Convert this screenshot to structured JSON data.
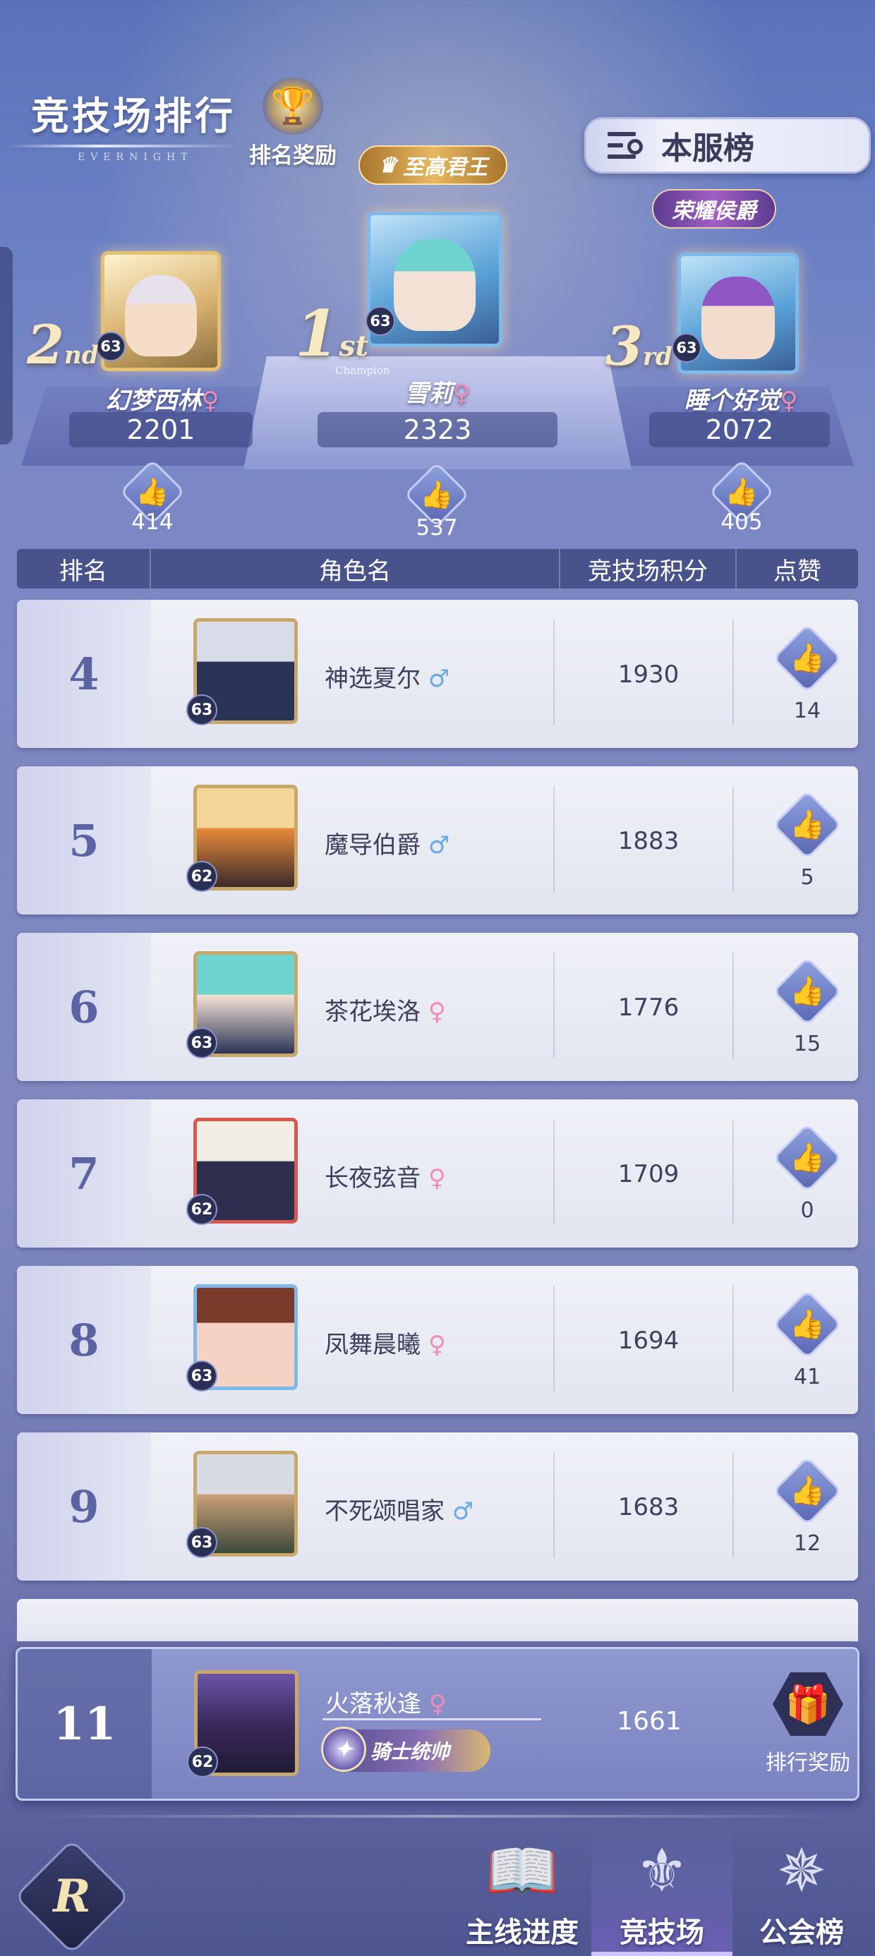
{
  "header": {
    "title": "竞技场排行",
    "subtitle": "EVERNIGHT",
    "reward_label": "排名奖励",
    "server_button": "本服榜"
  },
  "podium": {
    "champion_text": "Champion",
    "first": {
      "rank": "1",
      "suffix": "st",
      "title": "至高君王",
      "name": "雪莉",
      "gender": "♀",
      "score": "2323",
      "likes": "537",
      "level": "63"
    },
    "second": {
      "rank": "2",
      "suffix": "nd",
      "name": "幻梦西林",
      "gender": "♀",
      "score": "2201",
      "likes": "414",
      "level": "63"
    },
    "third": {
      "rank": "3",
      "suffix": "rd",
      "title": "荣耀侯爵",
      "name": "睡个好觉",
      "gender": "♀",
      "score": "2072",
      "likes": "405",
      "level": "63"
    }
  },
  "table": {
    "headers": [
      "排名",
      "角色名",
      "竞技场积分",
      "点赞"
    ],
    "rows": [
      {
        "rank": "4",
        "name": "神选夏尔",
        "gender": "♂",
        "score": "1930",
        "likes": "14",
        "level": "63"
      },
      {
        "rank": "5",
        "name": "魔导伯爵",
        "gender": "♂",
        "score": "1883",
        "likes": "5",
        "level": "62"
      },
      {
        "rank": "6",
        "name": "茶花埃洛",
        "gender": "♀",
        "score": "1776",
        "likes": "15",
        "level": "63"
      },
      {
        "rank": "7",
        "name": "长夜弦音",
        "gender": "♀",
        "score": "1709",
        "likes": "0",
        "level": "62"
      },
      {
        "rank": "8",
        "name": "凤舞晨曦",
        "gender": "♀",
        "score": "1694",
        "likes": "41",
        "level": "63"
      },
      {
        "rank": "9",
        "name": "不死颂唱家",
        "gender": "♂",
        "score": "1683",
        "likes": "12",
        "level": "63"
      }
    ]
  },
  "self": {
    "rank": "11",
    "name": "火落秋逢",
    "gender": "♀",
    "title": "骑士统帅",
    "score": "1661",
    "level": "62",
    "reward_label": "排行奖励"
  },
  "nav": {
    "logo": "R",
    "items": [
      "主线进度",
      "竞技场",
      "公会榜"
    ]
  },
  "colors": {
    "female": "#f08db4",
    "male": "#68a9ea",
    "accent": "#6a5fb3"
  }
}
